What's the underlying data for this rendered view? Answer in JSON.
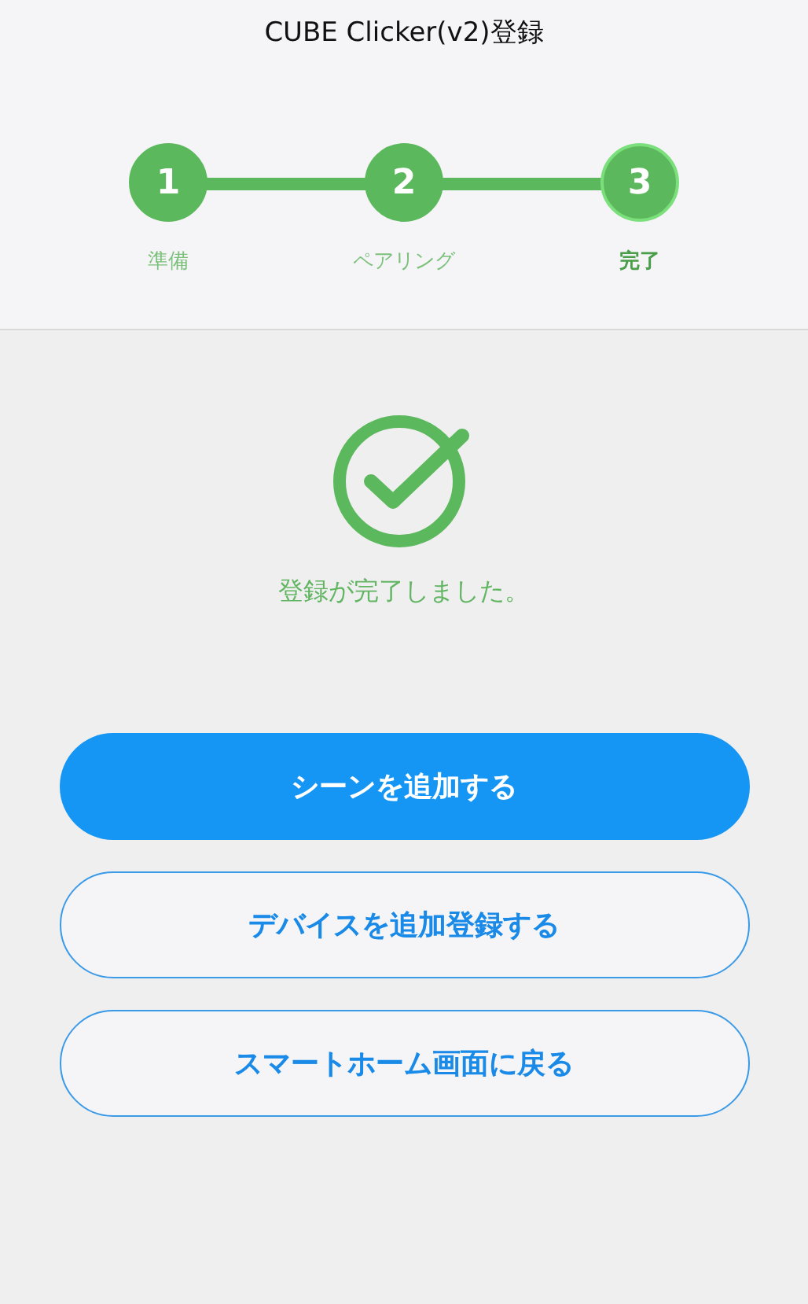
{
  "header": {
    "title": "CUBE Clicker(v2)登録"
  },
  "steps": [
    {
      "number": "1",
      "label": "準備",
      "selected": false
    },
    {
      "number": "2",
      "label": "ペアリング",
      "selected": false
    },
    {
      "number": "3",
      "label": "完了",
      "selected": true
    }
  ],
  "message": "登録が完了しました。",
  "buttons": [
    {
      "label": "シーンを追加する",
      "kind": "primary"
    },
    {
      "label": "デバイスを追加登録する",
      "kind": "outline"
    },
    {
      "label": "スマートホーム画面に戻る",
      "kind": "outline"
    }
  ]
}
